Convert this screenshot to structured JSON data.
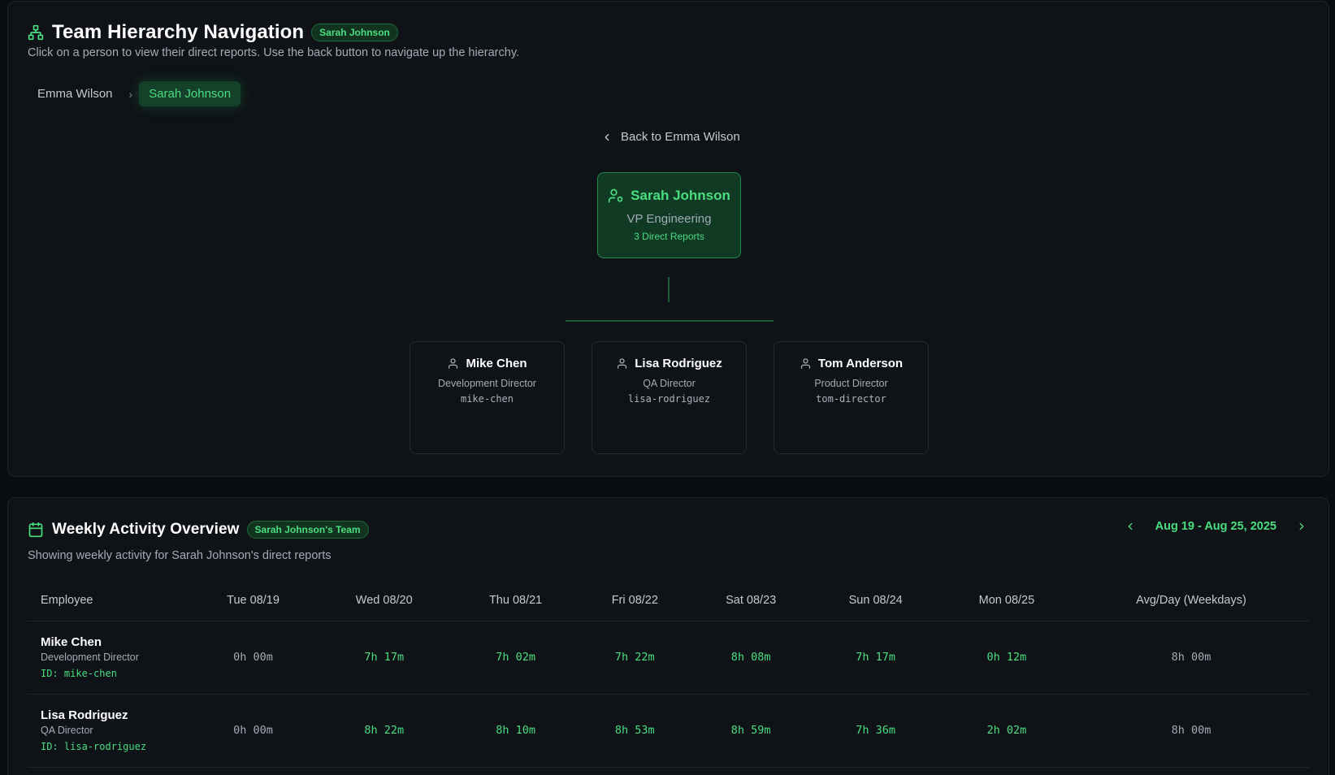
{
  "hierarchy": {
    "title": "Team Hierarchy Navigation",
    "badge": "Sarah Johnson",
    "subtitle": "Click on a person to view their direct reports. Use the back button to navigate up the hierarchy.",
    "breadcrumbs": [
      "Emma Wilson",
      "Sarah Johnson"
    ],
    "back_label": "Back to Emma Wilson",
    "root": {
      "name": "Sarah Johnson",
      "role": "VP Engineering",
      "reports": "3 Direct Reports"
    },
    "children": [
      {
        "name": "Mike Chen",
        "role": "Development Director",
        "id": "mike-chen"
      },
      {
        "name": "Lisa Rodriguez",
        "role": "QA Director",
        "id": "lisa-rodriguez"
      },
      {
        "name": "Tom Anderson",
        "role": "Product Director",
        "id": "tom-director"
      }
    ]
  },
  "weekly": {
    "title": "Weekly Activity Overview",
    "badge": "Sarah Johnson's Team",
    "subtitle": "Showing weekly activity for Sarah Johnson's direct reports",
    "range": "Aug 19 - Aug 25, 2025",
    "columns": [
      "Employee",
      "Tue 08/19",
      "Wed 08/20",
      "Thu 08/21",
      "Fri 08/22",
      "Sat 08/23",
      "Sun 08/24",
      "Mon 08/25",
      "Avg/Day (Weekdays)"
    ],
    "rows": [
      {
        "name": "Mike Chen",
        "role": "Development Director",
        "id": "ID: mike-chen",
        "values": [
          "0h 00m",
          "7h 17m",
          "7h 02m",
          "7h 22m",
          "8h 08m",
          "7h 17m",
          "0h 12m"
        ],
        "avg": "8h 00m"
      },
      {
        "name": "Lisa Rodriguez",
        "role": "QA Director",
        "id": "ID: lisa-rodriguez",
        "values": [
          "0h 00m",
          "8h 22m",
          "8h 10m",
          "8h 53m",
          "8h 59m",
          "7h 36m",
          "2h 02m"
        ],
        "avg": "8h 00m"
      }
    ]
  },
  "colors": {
    "accent": "#4ade80",
    "accent_bg": "#15402a",
    "background": "#0b0e11",
    "panel": "#0f1317"
  },
  "icons": [
    "org-chart-icon",
    "chevron-right-icon",
    "chevron-left-icon",
    "user-cog-icon",
    "user-icon",
    "calendar-icon"
  ]
}
